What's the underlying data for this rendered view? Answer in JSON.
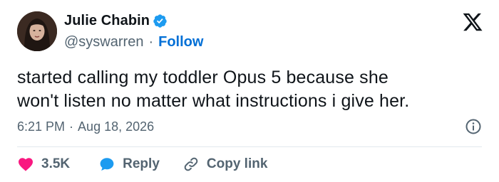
{
  "author": {
    "display_name": "Julie Chabin",
    "handle": "@syswarren",
    "separator": "·",
    "follow_label": "Follow"
  },
  "tweet": {
    "text_line1": "started calling my toddler Opus 5 because she",
    "text_line2": "won't listen no matter what instructions i give her."
  },
  "meta": {
    "time": "6:21 PM",
    "separator": "·",
    "date": "Aug 18, 2026"
  },
  "actions": {
    "like_count": "3.5K",
    "reply_label": "Reply",
    "copy_label": "Copy link"
  },
  "colors": {
    "verified": "#1d9bf0",
    "follow": "#006fd6",
    "heart": "#f91880",
    "reply_bubble": "#1d9bf0",
    "secondary_text": "#536471"
  },
  "icons": [
    "verified-badge-icon",
    "x-logo-icon",
    "info-icon",
    "heart-icon",
    "reply-bubble-icon",
    "link-icon"
  ]
}
